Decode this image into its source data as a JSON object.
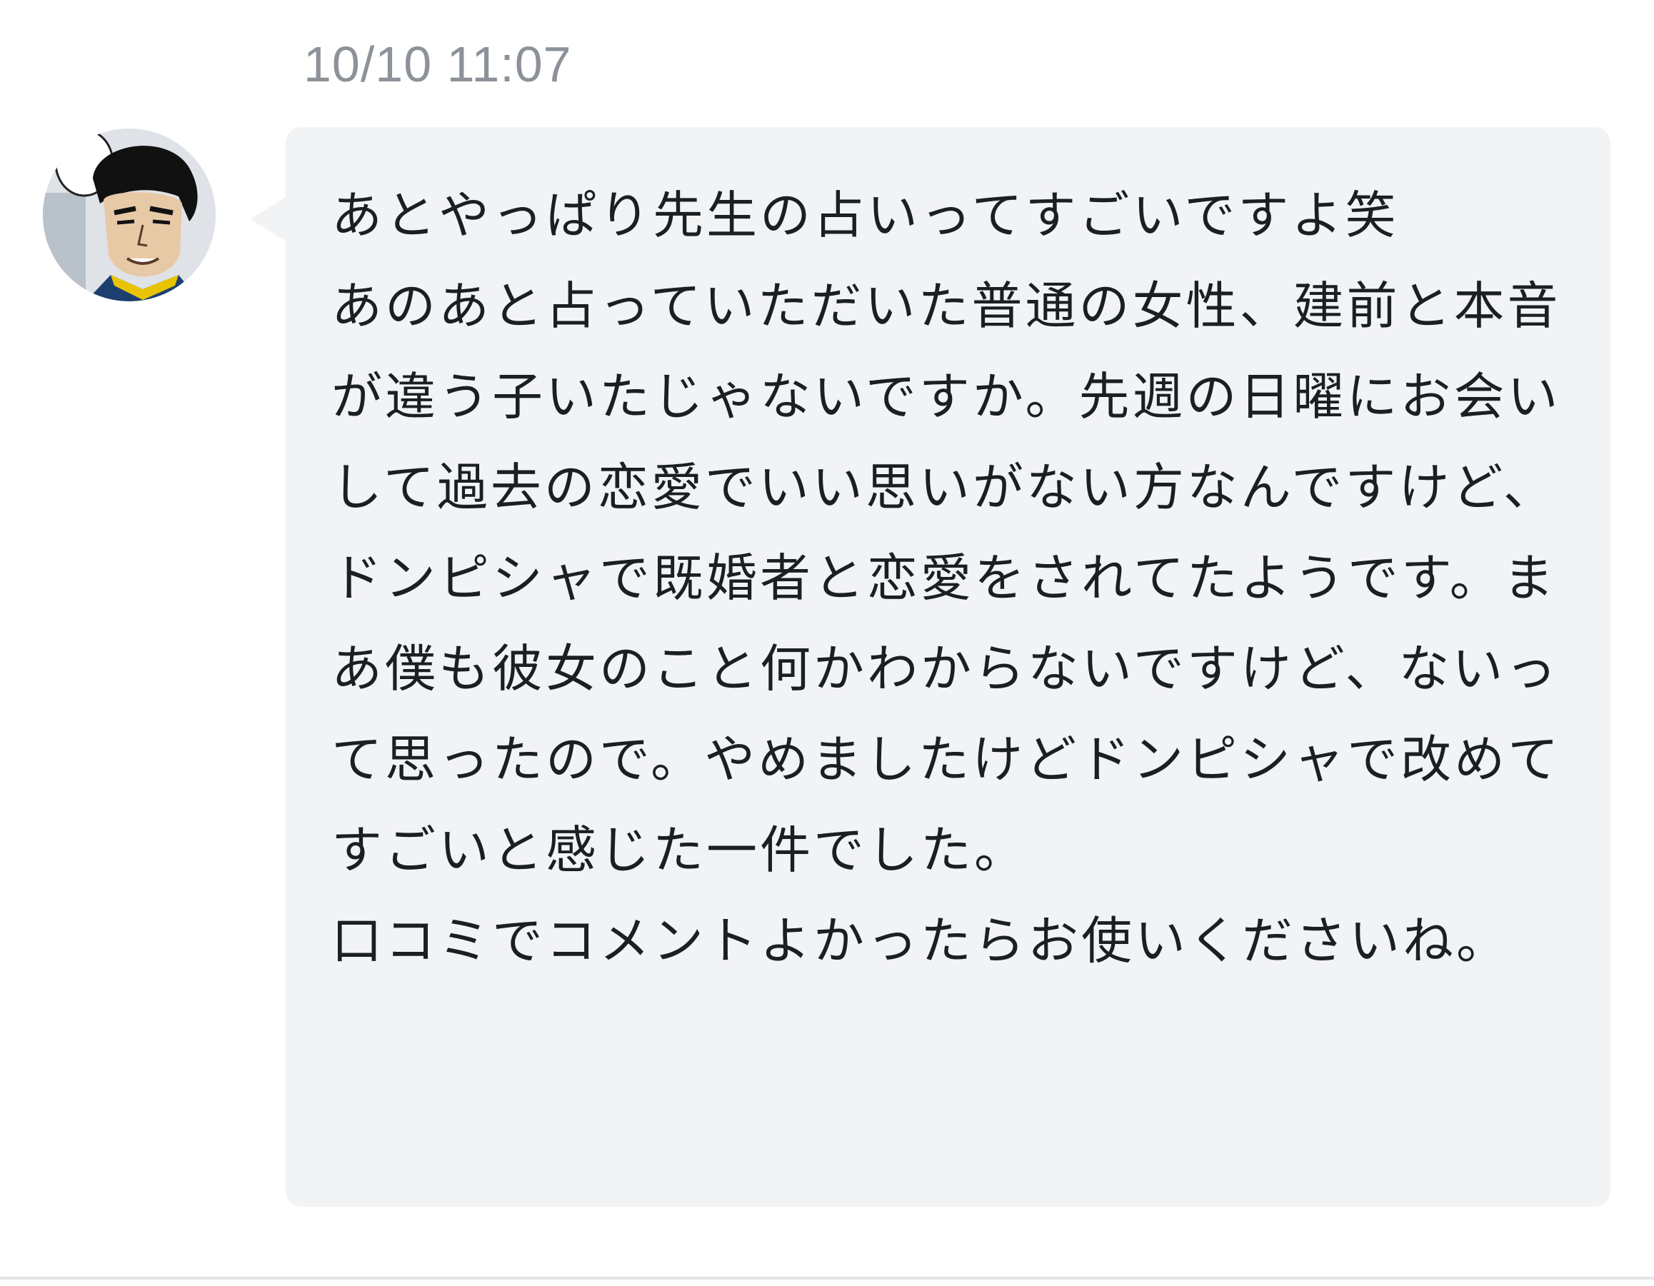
{
  "message": {
    "timestamp": "10/10 11:07",
    "text": "あとやっぱり先生の占いってすごいですよ笑\nあのあと占っていただいた普通の女性、建前と本音が違う子いたじゃないですか。先週の日曜にお会いして過去の恋愛でいい思いがない方なんですけど、ドンピシャで既婚者と恋愛をされてたようです。まあ僕も彼女のこと何かわからないですけど、ないって思ったので。やめましたけどドンピシャで改めてすごいと感じた一件でした。\n口コミでコメントよかったらお使いくださいね。",
    "avatar_icon": "user-avatar-icon"
  },
  "colors": {
    "bubble_background": "#f2f3f5",
    "text": "#1b1f24",
    "timestamp": "#8c9298",
    "divider": "#e3e4e6"
  }
}
